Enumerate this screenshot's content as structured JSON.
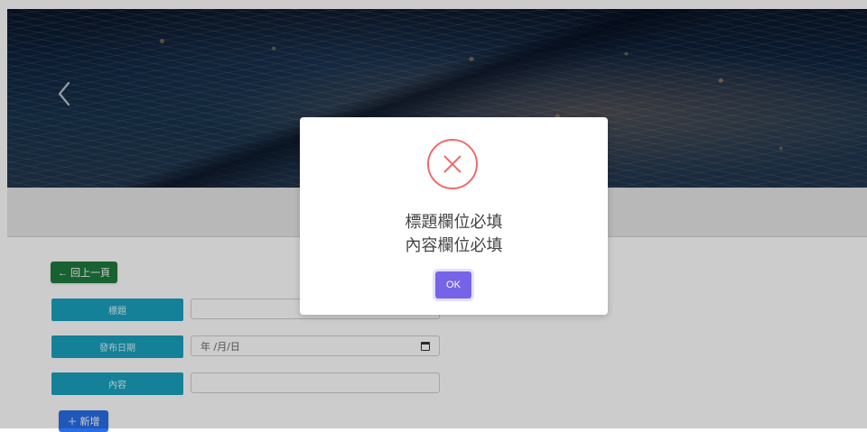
{
  "banner": {
    "prev_icon": "chevron-left-icon"
  },
  "actions": {
    "back_label": "← 回上一頁",
    "add_label": "＋ 新增"
  },
  "form": {
    "title_label": "標題",
    "date_label": "發布日期",
    "content_label": "內容",
    "date_value": "年 /月/日"
  },
  "dialog": {
    "icon": "error-circle-x-icon",
    "line1": "標題欄位必填",
    "line2": "內容欄位必填",
    "ok_label": "OK"
  }
}
